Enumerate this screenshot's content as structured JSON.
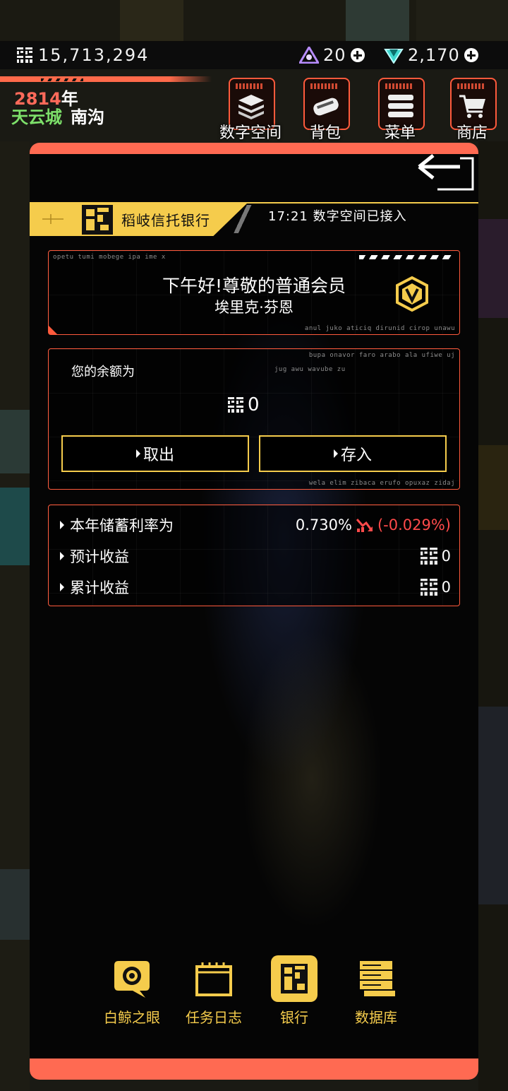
{
  "hud": {
    "money": "15,713,294",
    "crystal": "20",
    "gems": "2,170"
  },
  "location": {
    "year": "2814",
    "year_suffix": "年",
    "city": "天云城",
    "district": "南沟"
  },
  "top_nav": [
    {
      "label": "数字空间",
      "icon": "layers-icon"
    },
    {
      "label": "背包",
      "icon": "bag-icon"
    },
    {
      "label": "菜单",
      "icon": "menu-icon"
    },
    {
      "label": "商店",
      "icon": "cart-icon"
    }
  ],
  "bank": {
    "name": "稻岐信托银行",
    "status": "17:21 数字空间已接入",
    "greeting": "下午好!尊敬的普通会员",
    "member_name": "埃里克·芬恩",
    "micro_1": "opetu tumi mobege ipa ime x",
    "micro_2": "anul juko aticiq dirunid cirop unawu",
    "micro_3": "bupa onavor faro arabo ala ufiwe uj",
    "micro_4": "jug awu wavube zu",
    "micro_5": "wela elim zibaca erufo opuxaz zidaj",
    "balance_label": "您的余额为",
    "balance_value": "0",
    "withdraw_label": "取出",
    "deposit_label": "存入",
    "rate_label": "本年储蓄利率为",
    "rate_value": "0.730%",
    "rate_change": "(-0.029%)",
    "expected_label": "预计收益",
    "expected_value": "0",
    "accumulated_label": "累计收益",
    "accumulated_value": "0"
  },
  "bottom_nav": [
    {
      "label": "白鲸之眼",
      "icon": "eye-icon"
    },
    {
      "label": "任务日志",
      "icon": "calendar-icon"
    },
    {
      "label": "银行",
      "icon": "bank-icon"
    },
    {
      "label": "数据库",
      "icon": "database-icon"
    }
  ],
  "colors": {
    "accent_orange": "#ff6a52",
    "accent_yellow": "#f5cc4c",
    "city_green": "#7de06a",
    "negative_red": "#ff4a4a"
  }
}
